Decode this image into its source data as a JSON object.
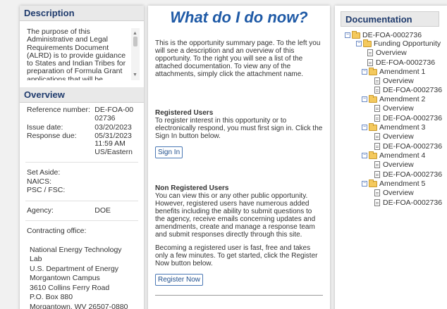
{
  "description": {
    "heading": "Description",
    "text": "The purpose of this Administrative and Legal Requirements Document (ALRD) is to provide guidance to States and Indian Tribes for preparation of Formula Grant applications that will be submitted..."
  },
  "overview": {
    "heading": "Overview",
    "reference_label": "Reference number:",
    "reference_value": "DE-FOA-0002736",
    "issue_label": "Issue date:",
    "issue_value": "03/20/2023",
    "response_label": "Response due:",
    "response_value": "05/31/2023 11:59 AM US/Eastern",
    "set_aside_label": "Set Aside:",
    "naics_label": "NAICS:",
    "psc_label": "PSC / FSC:",
    "agency_label": "Agency:",
    "agency_value": "DOE",
    "office_label": "Contracting office:",
    "address": [
      "National Energy Technology Lab",
      "U.S. Department of Energy",
      "Morgantown Campus",
      "3610 Collins Ferry Road",
      "P.O. Box 880",
      "Morgantown, WV 26507-0880"
    ]
  },
  "main": {
    "title": "What do I do now?",
    "intro": "This is the opportunity summary page. To the left you will see a description and an overview of this opportunity. To the right you will see a list of the attached documentation. To view any of the attachments, simply click the attachment name.",
    "registered_heading": "Registered Users",
    "registered_text": "To register interest in this opportunity or to electronically respond, you must first sign in. Click the Sign In button below.",
    "signin_label": "Sign In",
    "nonreg_heading": "Non Registered Users",
    "nonreg_text": "You can view this or any other public opportunity. However, registered users have numerous added benefits including the ability to submit questions to the agency, receive emails concerning updates and amendments, create and manage a response team and submit responses directly through this site.",
    "nonreg_text2": "Becoming a registered user is fast, free and takes only a few minutes. To get started, click the Register Now button below.",
    "register_label": "Register Now"
  },
  "documentation": {
    "heading": "Documentation",
    "root": "DE-FOA-0002736",
    "folders": [
      {
        "name": "Funding Opportunity",
        "children": [
          "Overview",
          "DE-FOA-0002736"
        ]
      },
      {
        "name": "Amendment 1",
        "children": [
          "Overview",
          "DE-FOA-0002736"
        ]
      },
      {
        "name": "Amendment 2",
        "children": [
          "Overview",
          "DE-FOA-0002736"
        ]
      },
      {
        "name": "Amendment 3",
        "children": [
          "Overview",
          "DE-FOA-0002736"
        ]
      },
      {
        "name": "Amendment 4",
        "children": [
          "Overview",
          "DE-FOA-0002736"
        ]
      },
      {
        "name": "Amendment 5",
        "children": [
          "Overview",
          "DE-FOA-0002736"
        ]
      }
    ]
  },
  "colors": {
    "title": "#1f5aa6",
    "heading": "#1f3b6d",
    "button_border": "#4a78b5"
  },
  "icons": {
    "toggle": "collapse-toggle-icon",
    "folder": "folder-icon",
    "document": "document-icon"
  }
}
